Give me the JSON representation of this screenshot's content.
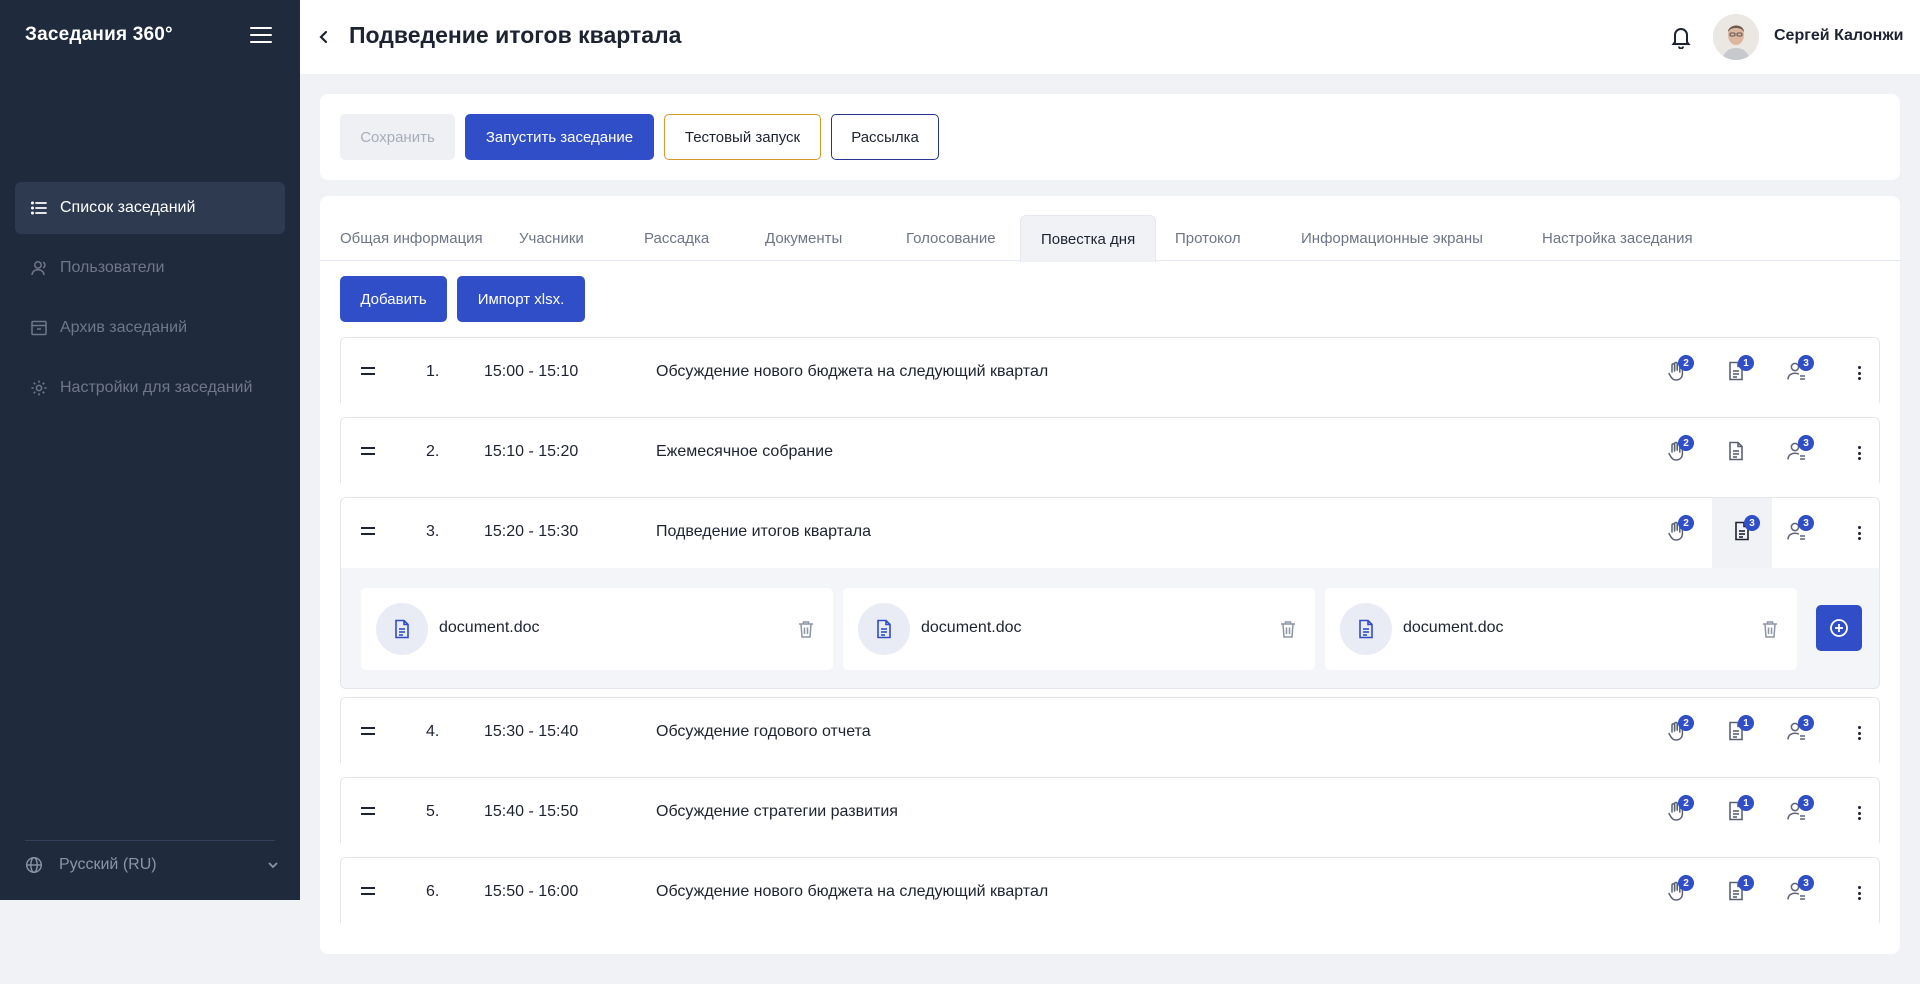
{
  "sidebar": {
    "brand": "Заседания 360°",
    "items": [
      {
        "label": "Список заседаний",
        "active": true,
        "icon": "list-icon"
      },
      {
        "label": "Пользователи",
        "icon": "users-icon"
      },
      {
        "label": "Архив заседаний",
        "icon": "archive-icon"
      },
      {
        "label": "Настройки для заседаний",
        "icon": "gear-icon"
      }
    ],
    "language": "Русский (RU)"
  },
  "header": {
    "title": "Подведение итогов квартала",
    "user_name": "Сергей Калонжи"
  },
  "toolbar": {
    "save": "Сохранить",
    "start": "Запустить заседание",
    "test": "Тестовый запуск",
    "mailing": "Рассылка"
  },
  "tabs": [
    {
      "label": "Общая информация"
    },
    {
      "label": "Учасники"
    },
    {
      "label": "Рассадка"
    },
    {
      "label": "Документы"
    },
    {
      "label": "Голосование"
    },
    {
      "label": "Повестка дня",
      "active": true
    },
    {
      "label": "Протокол"
    },
    {
      "label": "Информационные экраны"
    },
    {
      "label": "Настройка заседания"
    }
  ],
  "actions": {
    "add": "Добавить",
    "import": "Импорт xlsx."
  },
  "agenda": [
    {
      "num": "1.",
      "time": "15:00 - 15:10",
      "topic": "Обсуждение нового бюджета на следующий квартал",
      "votes": "2",
      "docs": "1",
      "people": "3"
    },
    {
      "num": "2.",
      "time": "15:10 - 15:20",
      "topic": "Ежемесячное собрание",
      "votes": "2",
      "docs": "",
      "people": "3"
    },
    {
      "num": "3.",
      "time": "15:20 - 15:30",
      "topic": "Подведение итогов квартала",
      "votes": "2",
      "docs": "3",
      "people": "3",
      "expanded": true,
      "documents": [
        {
          "name": "document.doc"
        },
        {
          "name": "document.doc"
        },
        {
          "name": "document.doc"
        }
      ]
    },
    {
      "num": "4.",
      "time": "15:30 - 15:40",
      "topic": "Обсуждение годового отчета",
      "votes": "2",
      "docs": "1",
      "people": "3"
    },
    {
      "num": "5.",
      "time": "15:40 - 15:50",
      "topic": "Обсуждение стратегии развития",
      "votes": "2",
      "docs": "1",
      "people": "3"
    },
    {
      "num": "6.",
      "time": "15:50 - 16:00",
      "topic": "Обсуждение нового бюджета на следующий квартал",
      "votes": "2",
      "docs": "1",
      "people": "3"
    }
  ],
  "colors": {
    "primary": "#2f4ec7",
    "sidebar": "#1f2a3c",
    "test_border": "#d69a2a",
    "mailing_border": "#27378f"
  }
}
